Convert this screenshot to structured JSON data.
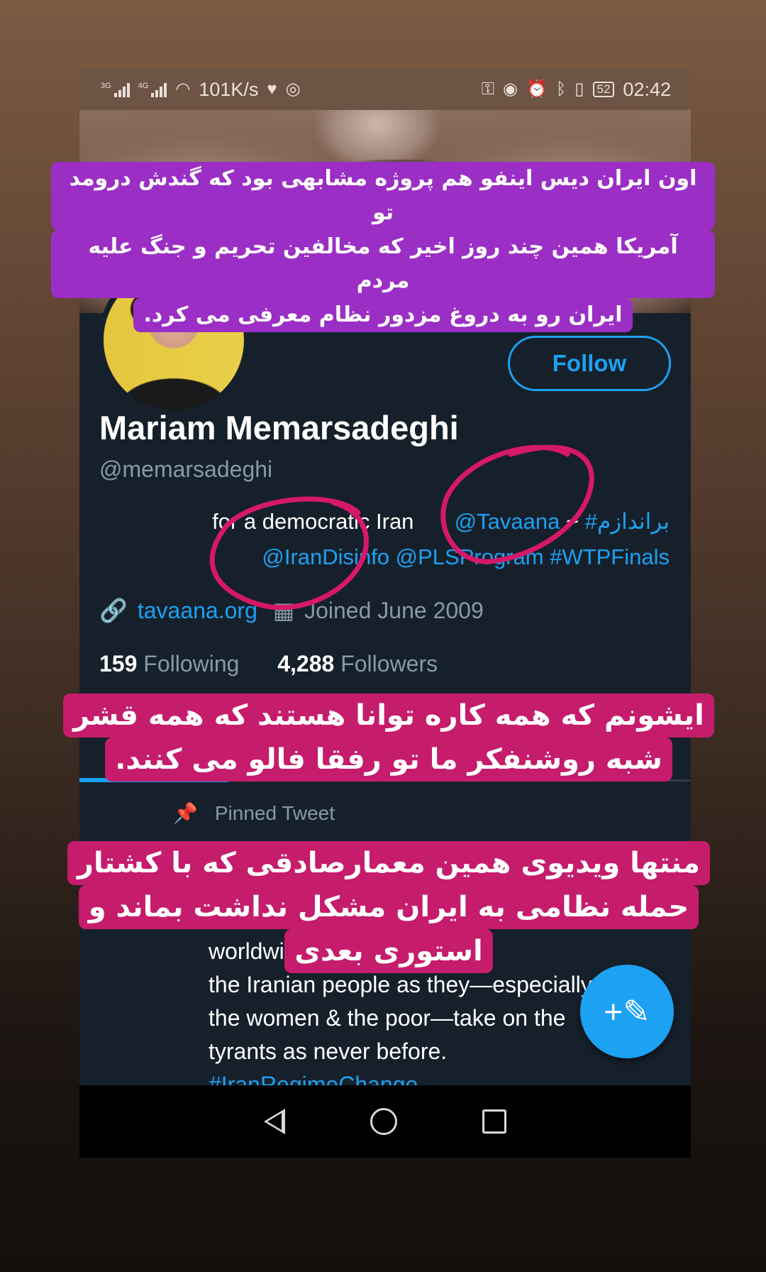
{
  "status_bar": {
    "net_speed": "101K/s",
    "battery": "52",
    "time": "02:42",
    "signal_1": "3G",
    "signal_2": "4G"
  },
  "profile": {
    "follow_label": "Follow",
    "name": "Mariam Memarsadeghi",
    "handle": "@memarsadeghi",
    "bio_line1_prefix": "for a democratic Iran",
    "bio_line1_link": "@Tavaana",
    "bio_line1_sep": " ~ ",
    "bio_line1_hashtag": "#براندازم",
    "bio_line2_links": "@IranDisinfo @PLSProgram #WTPFinals",
    "website": "tavaana.org",
    "joined": "Joined June 2009",
    "following_count": "159",
    "following_label": "Following",
    "followers_count": "4,288",
    "followers_label": "Followers"
  },
  "pinned_label": "Pinned Tweet",
  "tweet": {
    "lines": [
      "worldwide in the solidarity of",
      "the Iranian people as they—especially",
      "the women & the poor—take on the",
      "tyrants as never before."
    ],
    "hashtag": "#IranRegimeChange"
  },
  "captions": {
    "top": [
      "اون ایران دیس اینفو هم پروژه مشابهی بود که گندش درومد تو",
      "آمریکا همین چند روز اخیر که مخالفین تحریم و جنگ علیه مردم",
      "ایران رو به دروغ مزدور نظام معرفی می کرد."
    ],
    "middle": [
      "ایشونم که همه کاره توانا هستند که همه قشر",
      "شبه روشنفکر ما تو رفقا فالو می کنند."
    ],
    "bottom": [
      "منتها ویدیوی همین معمارصادقی که با کشتار",
      "حمله نظامی به ایران مشکل نداشت بماند و",
      "استوری بعدی"
    ]
  },
  "colors": {
    "twitter_blue": "#1da1f2",
    "caption_purple": "#9b2fc5",
    "caption_pink": "#c51c6c",
    "annotation_circle": "#d6186a"
  },
  "icons": [
    "back-arrow-icon",
    "more-vert-icon",
    "link-icon",
    "calendar-icon",
    "pin-icon",
    "compose-tweet-icon"
  ]
}
